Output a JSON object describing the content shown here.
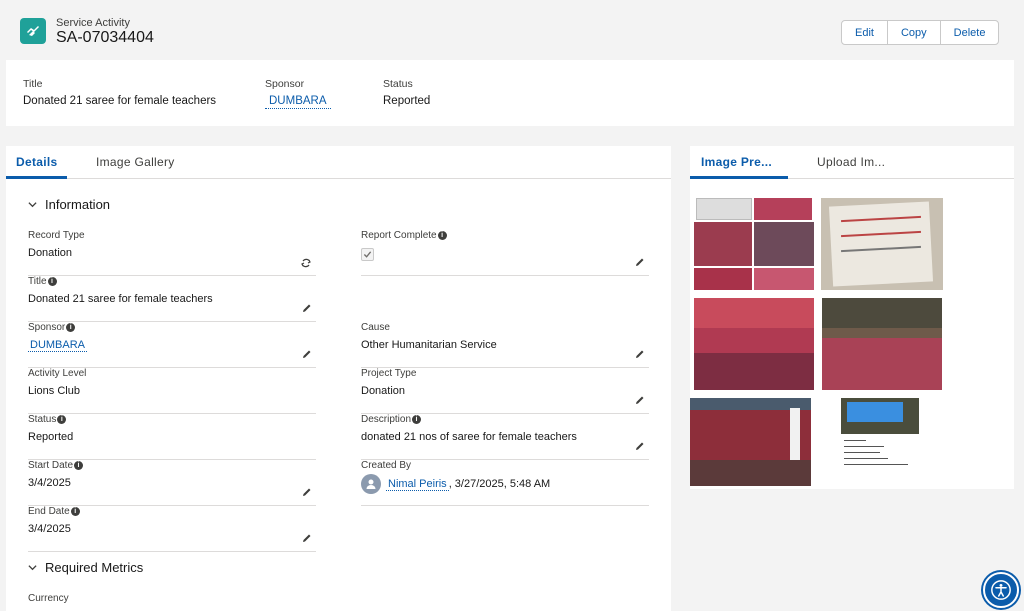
{
  "header": {
    "object_label": "Service Activity",
    "record_name": "SA-07034404",
    "actions": {
      "edit": "Edit",
      "copy": "Copy",
      "delete": "Delete"
    }
  },
  "highlights": {
    "title": {
      "label": "Title",
      "value": "Donated 21 saree for female teachers"
    },
    "sponsor": {
      "label": "Sponsor",
      "value": "DUMBARA"
    },
    "status": {
      "label": "Status",
      "value": "Reported"
    }
  },
  "tabs": {
    "details": "Details",
    "gallery": "Image Gallery"
  },
  "sections": {
    "information": "Information",
    "metrics": "Required Metrics"
  },
  "fields": {
    "record_type": {
      "label": "Record Type",
      "value": "Donation"
    },
    "report_complete": {
      "label": "Report Complete",
      "checked": true
    },
    "title": {
      "label": "Title",
      "value": "Donated 21 saree for female teachers"
    },
    "sponsor": {
      "label": "Sponsor",
      "value": "DUMBARA"
    },
    "cause": {
      "label": "Cause",
      "value": "Other Humanitarian Service"
    },
    "activity_level": {
      "label": "Activity Level",
      "value": "Lions Club"
    },
    "project_type": {
      "label": "Project Type",
      "value": "Donation"
    },
    "status": {
      "label": "Status",
      "value": "Reported"
    },
    "description": {
      "label": "Description",
      "value": "donated 21 nos of saree for female teachers"
    },
    "start_date": {
      "label": "Start Date",
      "value": "3/4/2025"
    },
    "created_by": {
      "label": "Created By",
      "user": "Nimal Peiris",
      "timestamp": ", 3/27/2025, 5:48 AM"
    },
    "end_date": {
      "label": "End Date",
      "value": "3/4/2025"
    },
    "currency": {
      "label": "Currency"
    }
  },
  "side_tabs": {
    "preview": "Image Pre...",
    "upload": "Upload Im..."
  },
  "colors": {
    "brand": "#0b5cab",
    "record_icon": "#1fa199"
  }
}
